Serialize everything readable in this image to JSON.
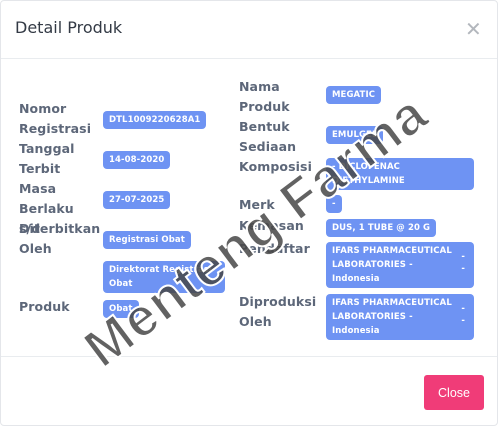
{
  "modal": {
    "title": "Detail Produk",
    "close_icon": "close-icon",
    "close_button": "Close"
  },
  "left": {
    "nomor_registrasi_label": "Nomor Registrasi",
    "nomor_registrasi_value": "DTL1009220628A1",
    "tanggal_terbit_label": "Tanggal Terbit",
    "tanggal_terbit_value": "14-08-2020",
    "masa_berlaku_label": "Masa Berlaku s/d",
    "masa_berlaku_value": "27-07-2025",
    "diterbitkan_oleh_label": "Diterbitkan Oleh",
    "diterbitkan_oleh_value": "Registrasi Obat",
    "direktorat_value": "Direktorat Registrasi Obat",
    "produk_label": "Produk",
    "produk_value": "Obat"
  },
  "right": {
    "nama_produk_label": "Nama Produk",
    "nama_produk_value": "MEGATIC",
    "bentuk_sediaan_label": "Bentuk Sediaan",
    "bentuk_sediaan_value": "EMULGEL",
    "komposisi_label": "Komposisi",
    "komposisi_value": "- DICLOFENAC DIETHYLAMINE",
    "merk_label": "Merk",
    "merk_value": "-",
    "kemasan_label": "Kemasan",
    "kemasan_value": "DUS, 1 TUBE @ 20 G",
    "pendaftar_label": "Pendaftar",
    "pendaftar_value": "IFARS PHARMACEUTICAL LABORATORIES - Indonesia",
    "diproduksi_oleh_label": "Diproduksi Oleh",
    "diproduksi_oleh_value": "IFARS PHARMACEUTICAL LABORATORIES - Indonesia",
    "dash": "-"
  },
  "watermark": "Menteng Farma",
  "colors": {
    "badge": "#6e93f3",
    "close_button": "#f03c78",
    "label": "#5d6779"
  }
}
